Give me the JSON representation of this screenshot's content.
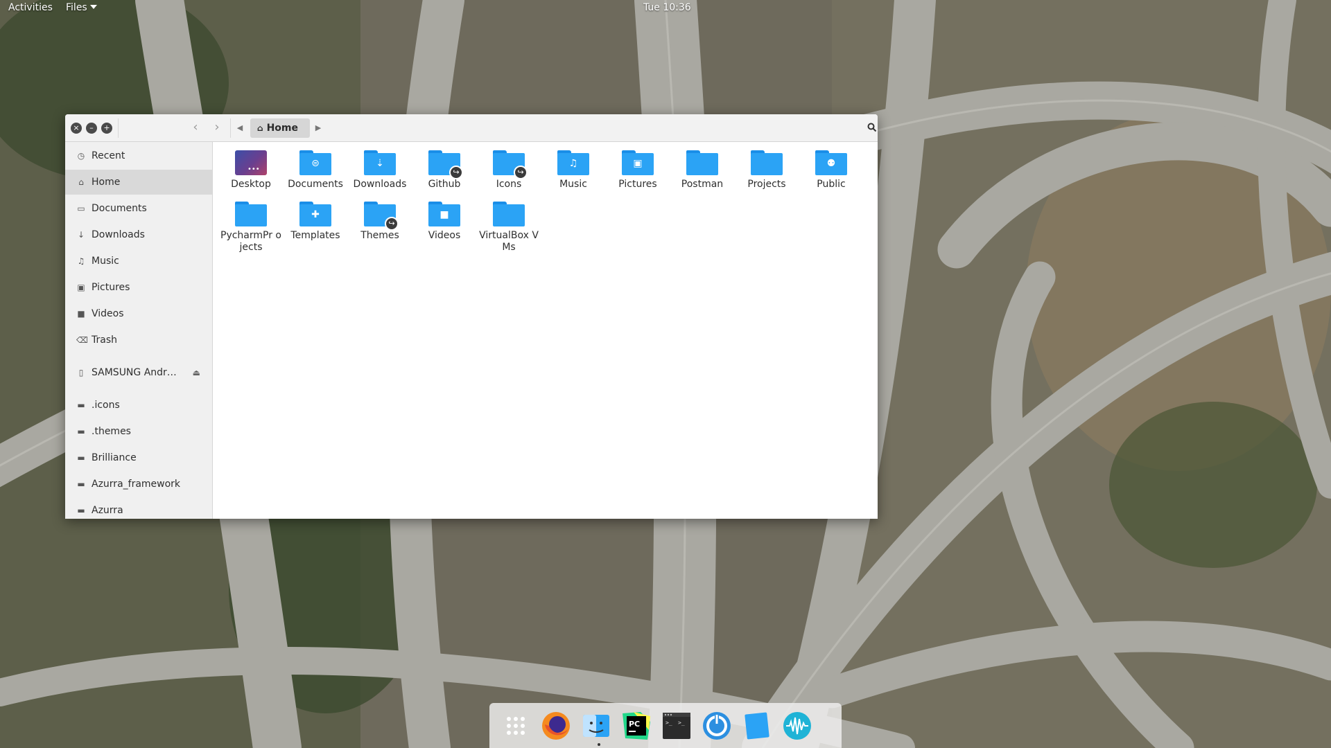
{
  "topbar": {
    "activities": "Activities",
    "app_menu": "Files",
    "clock": "Tue 10:36"
  },
  "window": {
    "pathbar": {
      "current": "Home"
    }
  },
  "sidebar": {
    "items": [
      {
        "label": "Recent",
        "icon": "clock-icon"
      },
      {
        "label": "Home",
        "icon": "home-icon",
        "active": true
      },
      {
        "label": "Documents",
        "icon": "document-icon"
      },
      {
        "label": "Downloads",
        "icon": "download-icon"
      },
      {
        "label": "Music",
        "icon": "music-icon"
      },
      {
        "label": "Pictures",
        "icon": "picture-icon"
      },
      {
        "label": "Videos",
        "icon": "video-icon"
      },
      {
        "label": "Trash",
        "icon": "trash-icon"
      }
    ],
    "device": {
      "label": "SAMSUNG Andr…",
      "icon": "phone-icon"
    },
    "bookmarks": [
      {
        "label": ".icons"
      },
      {
        "label": ".themes"
      },
      {
        "label": "Brilliance"
      },
      {
        "label": "Azurra_framework"
      },
      {
        "label": "Azurra"
      }
    ]
  },
  "files": [
    {
      "label": "Desktop",
      "kind": "desktop"
    },
    {
      "label": "Documents",
      "kind": "folder",
      "glyph": "document-icon"
    },
    {
      "label": "Downloads",
      "kind": "folder",
      "glyph": "download-icon"
    },
    {
      "label": "Github",
      "kind": "folder-link"
    },
    {
      "label": "Icons",
      "kind": "folder-link"
    },
    {
      "label": "Music",
      "kind": "folder",
      "glyph": "music-icon"
    },
    {
      "label": "Pictures",
      "kind": "folder",
      "glyph": "picture-icon"
    },
    {
      "label": "Postman",
      "kind": "folder"
    },
    {
      "label": "Projects",
      "kind": "folder"
    },
    {
      "label": "Public",
      "kind": "folder",
      "glyph": "people-icon"
    },
    {
      "label": "PycharmPr ojects",
      "kind": "folder"
    },
    {
      "label": "Templates",
      "kind": "folder",
      "glyph": "puzzle-icon"
    },
    {
      "label": "Themes",
      "kind": "folder-link"
    },
    {
      "label": "Videos",
      "kind": "folder",
      "glyph": "video-icon"
    },
    {
      "label": "VirtualBox VMs",
      "kind": "folder"
    }
  ],
  "dock": {
    "apps": [
      {
        "icon": "app-grid-icon"
      },
      {
        "icon": "firefox-icon"
      },
      {
        "icon": "files-icon",
        "running": true
      },
      {
        "icon": "pycharm-icon"
      },
      {
        "icon": "terminal-icon"
      },
      {
        "icon": "power-icon"
      },
      {
        "icon": "blue-square-icon"
      },
      {
        "icon": "audio-wave-icon"
      }
    ]
  },
  "colors": {
    "folder": "#2ba3f5",
    "folder_tab": "#1a8ee8",
    "sidebar_bg": "#f0f0f0",
    "sidebar_active": "#d9d9d9"
  }
}
